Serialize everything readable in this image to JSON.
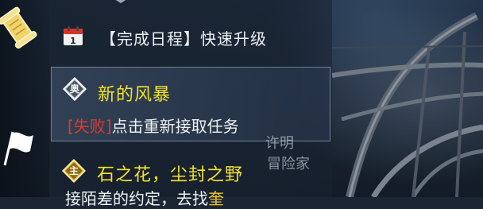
{
  "quest_tracker": {
    "schedule_title": "【完成日程】快速升级",
    "quests": [
      {
        "badge": "奥",
        "title": "新的风暴",
        "status_tag": "[失败]",
        "description": "点击重新接取任务"
      },
      {
        "badge": "主",
        "title": "石之花，尘封之野",
        "description_partial": "接陌差的约定，去找",
        "description_partial_accent": "奎"
      }
    ]
  },
  "left_toolbar": {
    "icons": [
      "scroll-icon",
      "flag-icon"
    ]
  },
  "watermark": {
    "line1": "许明",
    "line2": "冒险家"
  },
  "colors": {
    "title_yellow": "#f4e22c",
    "fail_red": "#e0382f",
    "text_white": "#eef1f4"
  }
}
